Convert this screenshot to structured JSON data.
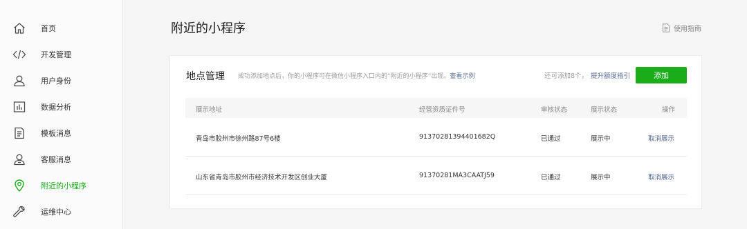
{
  "sidebar": {
    "items": [
      {
        "label": "首页",
        "icon": "home-icon"
      },
      {
        "label": "开发管理",
        "icon": "code-icon"
      },
      {
        "label": "用户身份",
        "icon": "user-icon"
      },
      {
        "label": "数据分析",
        "icon": "bar-chart-icon"
      },
      {
        "label": "模板消息",
        "icon": "document-icon"
      },
      {
        "label": "客服消息",
        "icon": "service-user-icon"
      },
      {
        "label": "附近的小程序",
        "icon": "location-pin-icon",
        "active": true
      },
      {
        "label": "运维中心",
        "icon": "wrench-icon"
      }
    ]
  },
  "header": {
    "title": "附近的小程序",
    "guide_label": "使用指南",
    "guide_icon": "document-icon"
  },
  "card": {
    "title": "地点管理",
    "desc": "成功添加地点后，你的小程序可在微信小程序入口内的“附近的小程序”出现。",
    "desc_link": "查看示例",
    "quota_text": "还可添加8个，",
    "quota_link": "提升额度指引",
    "add_button": "添加"
  },
  "table": {
    "headers": [
      "展示地址",
      "经营资质证件号",
      "审核状态",
      "展示状态",
      "操作"
    ],
    "rows": [
      {
        "address": "青岛市胶州市徐州路87号6楼",
        "license": "91370281394401682Q",
        "review": "已通过",
        "display": "展示中",
        "action": "取消展示"
      },
      {
        "address": "山东省青岛市胶州市经济技术开发区创业大厦",
        "license": "91370281MA3CAATJ59",
        "review": "已通过",
        "display": "展示中",
        "action": "取消展示"
      }
    ]
  },
  "colors": {
    "accent": "#1aad19",
    "link": "#576b95"
  }
}
